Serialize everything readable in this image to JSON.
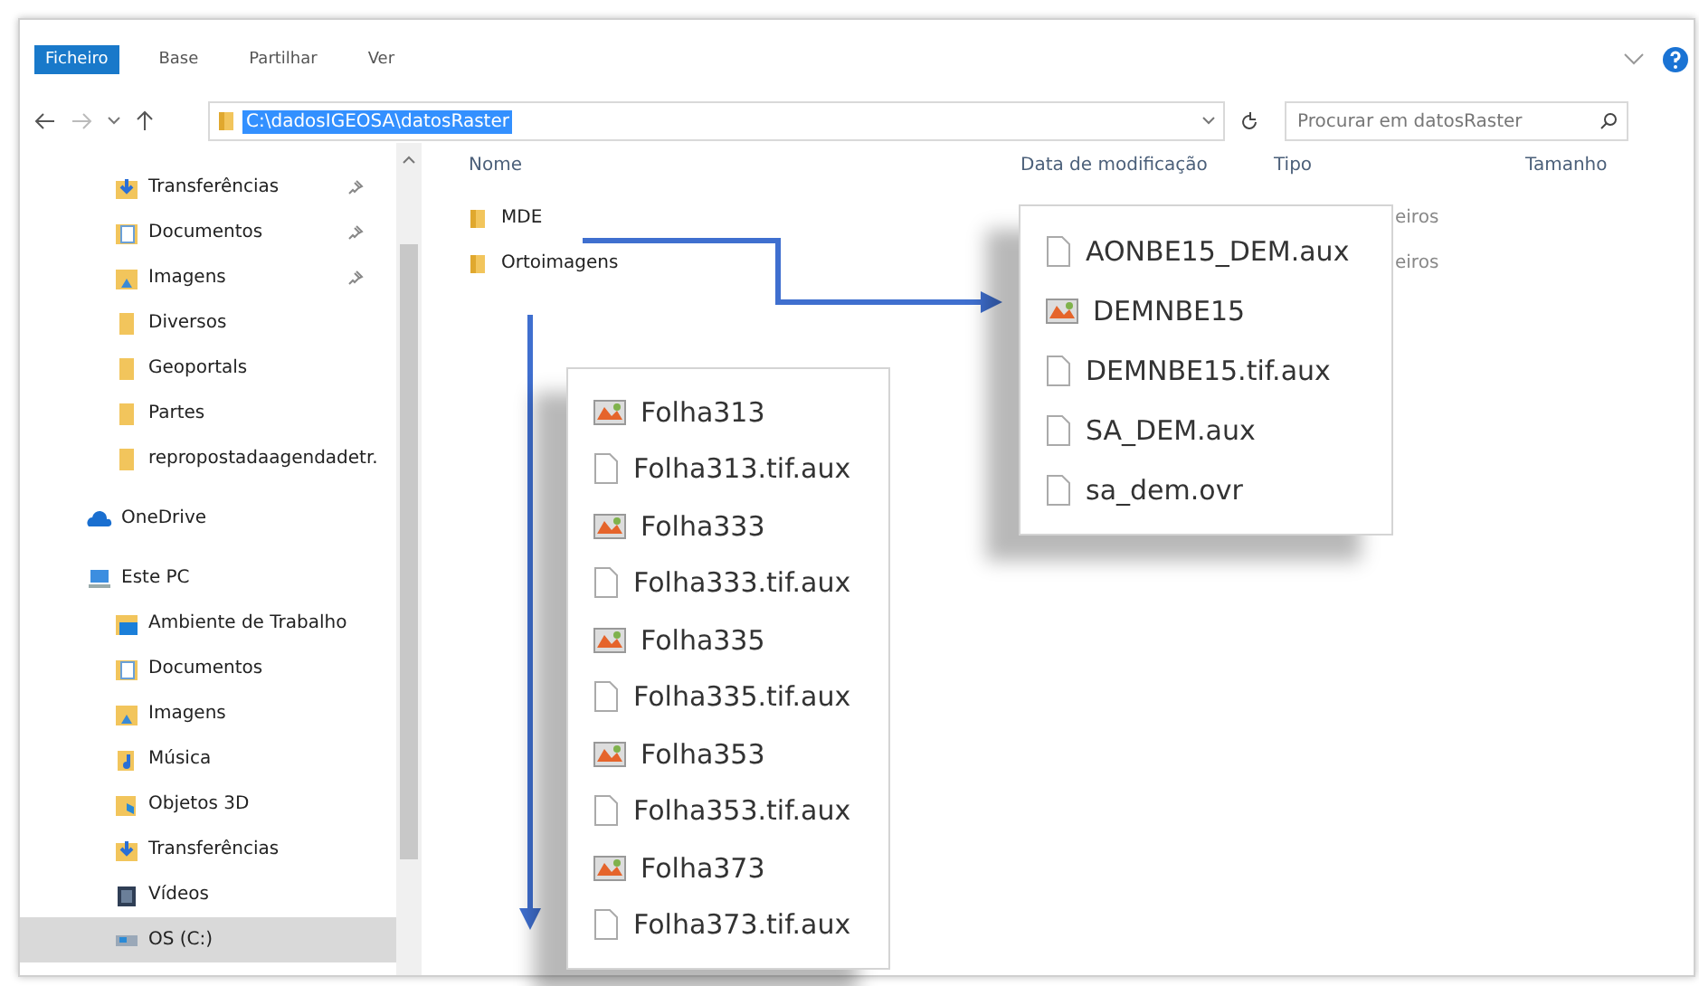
{
  "ribbon": {
    "tabs": [
      {
        "label": "Ficheiro",
        "selected": true
      },
      {
        "label": "Base",
        "selected": false
      },
      {
        "label": "Partilhar",
        "selected": false
      },
      {
        "label": "Ver",
        "selected": false
      }
    ]
  },
  "address": {
    "path": "C:\\dadosIGEOSA\\datosRaster",
    "selected": true
  },
  "search": {
    "placeholder": "Procurar em datosRaster"
  },
  "sidebar": {
    "quick_access": [
      {
        "label": "Transferências",
        "kind": "downloads",
        "pinned": true,
        "selected": false
      },
      {
        "label": "Documentos",
        "kind": "documents",
        "pinned": true,
        "selected": false
      },
      {
        "label": "Imagens",
        "kind": "pictures",
        "pinned": true,
        "selected": false
      },
      {
        "label": "Diversos",
        "kind": "folder",
        "pinned": false,
        "selected": false
      },
      {
        "label": "Geoportals",
        "kind": "folder",
        "pinned": false,
        "selected": false
      },
      {
        "label": "Partes",
        "kind": "folder",
        "pinned": false,
        "selected": false
      },
      {
        "label": "repropostadaagendadetr.",
        "kind": "folder",
        "pinned": false,
        "selected": false
      }
    ],
    "roots": [
      {
        "label": "OneDrive",
        "kind": "cloud",
        "selected": false
      },
      {
        "label": "Este PC",
        "kind": "pc",
        "selected": false,
        "children": [
          {
            "label": "Ambiente de Trabalho",
            "kind": "desktop",
            "selected": false
          },
          {
            "label": "Documentos",
            "kind": "documents",
            "selected": false
          },
          {
            "label": "Imagens",
            "kind": "pictures",
            "selected": false
          },
          {
            "label": "Música",
            "kind": "music",
            "selected": false
          },
          {
            "label": "Objetos 3D",
            "kind": "objects3d",
            "selected": false
          },
          {
            "label": "Transferências",
            "kind": "downloads",
            "selected": false
          },
          {
            "label": "Vídeos",
            "kind": "videos",
            "selected": false
          },
          {
            "label": "OS (C:)",
            "kind": "drive",
            "selected": true
          }
        ]
      }
    ]
  },
  "table": {
    "columns": [
      "Nome",
      "Data de modificação",
      "Tipo",
      "Tamanho"
    ],
    "rows": [
      {
        "name": "MDE",
        "type": "eiros"
      },
      {
        "name": "Ortoimagens",
        "type": "eiros"
      }
    ]
  },
  "callouts": [
    {
      "files": [
        {
          "name": "AONBE15_DEM.aux",
          "kind": "file"
        },
        {
          "name": "DEMNBE15",
          "kind": "raster"
        },
        {
          "name": "DEMNBE15.tif.aux",
          "kind": "file"
        },
        {
          "name": "SA_DEM.aux",
          "kind": "file"
        },
        {
          "name": "sa_dem.ovr",
          "kind": "file"
        }
      ]
    },
    {
      "files": [
        {
          "name": "Folha313",
          "kind": "raster"
        },
        {
          "name": "Folha313.tif.aux",
          "kind": "file"
        },
        {
          "name": "Folha333",
          "kind": "raster"
        },
        {
          "name": "Folha333.tif.aux",
          "kind": "file"
        },
        {
          "name": "Folha335",
          "kind": "raster"
        },
        {
          "name": "Folha335.tif.aux",
          "kind": "file"
        },
        {
          "name": "Folha353",
          "kind": "raster"
        },
        {
          "name": "Folha353.tif.aux",
          "kind": "file"
        },
        {
          "name": "Folha373",
          "kind": "raster"
        },
        {
          "name": "Folha373.tif.aux",
          "kind": "file"
        }
      ]
    }
  ]
}
